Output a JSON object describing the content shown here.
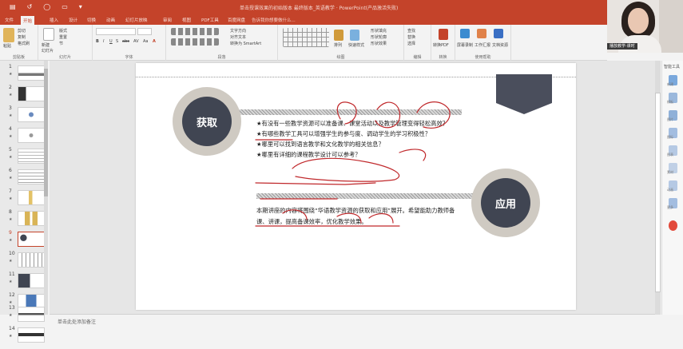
{
  "titlebar": {
    "title": "单击授课效果的初始版本 最终版本_英语教学 · PowerPoint(产品激活失败)",
    "qat": [
      "↺",
      "◯",
      "▭",
      "▾"
    ]
  },
  "tabs": [
    "文件",
    "开始",
    "插入",
    "设计",
    "切换",
    "动画",
    "幻灯片放映",
    "审阅",
    "视图",
    "PDF工具",
    "百度网盘"
  ],
  "active_tab": "开始",
  "tellme": "告诉我你想要做什么...",
  "ribbon": {
    "groups": [
      {
        "label": "剪贴板",
        "items": [
          "剪切",
          "复制",
          "格式刷",
          "粘贴"
        ]
      },
      {
        "label": "幻灯片",
        "items": [
          "新建",
          "幻灯片",
          "版式",
          "重置",
          "节"
        ]
      },
      {
        "label": "字体",
        "items": [
          "B",
          "I",
          "U",
          "S",
          "abc",
          "AV",
          "Aa",
          "A"
        ]
      },
      {
        "label": "段落",
        "items": [
          "文字方向",
          "对齐文本",
          "转换为 SmartArt"
        ]
      },
      {
        "label": "绘图",
        "items": [
          "排列",
          "快速样式",
          "形状填充",
          "形状轮廓",
          "形状效果"
        ]
      },
      {
        "label": "编辑",
        "items": [
          "查找",
          "替换",
          "选择"
        ]
      },
      {
        "label": "转换",
        "items": [
          "转换PDF"
        ]
      },
      {
        "label": "使用帮助",
        "items": [
          "屏幕录制",
          "工作汇报",
          "文档资源"
        ]
      }
    ]
  },
  "webcam": {
    "name_label": "播放教学·课时"
  },
  "thumbnails": [
    {
      "num": "1"
    },
    {
      "num": "2"
    },
    {
      "num": "3"
    },
    {
      "num": "4"
    },
    {
      "num": "5"
    },
    {
      "num": "6"
    },
    {
      "num": "7"
    },
    {
      "num": "8"
    },
    {
      "num": "9",
      "active": true
    },
    {
      "num": "10"
    },
    {
      "num": "11"
    },
    {
      "num": "12"
    },
    {
      "num": "13"
    },
    {
      "num": "14"
    }
  ],
  "slide": {
    "left_label": "获取",
    "right_label": "应用",
    "questions": [
      "★有没有一些教学资源可以准备课、课堂活动以及教学管理变得轻松高效？",
      "★有哪些教学工具可以增强学生的参与度、调动学生的学习积极性？",
      "★哪里可以找到语言教学和文化教学的相关信息？",
      "★哪里有详细的课程教学设计可以参考？"
    ],
    "paragraph": "本期讲座的内容将围绕“华语教学资源的获取和应用”展开。希望能助力教师备课、讲课，提高备课效率，优化教学效果。"
  },
  "notes_placeholder": "单击此处添加备注",
  "sidebar": {
    "top_label": "智能工具",
    "buttons": [
      "新建",
      "模板",
      "图片",
      "图标",
      "图表",
      "素材",
      "动画",
      "更多"
    ]
  },
  "colors": {
    "accent": "#c4432a",
    "dark_circle": "#404552",
    "ring": "#cfcac2"
  }
}
